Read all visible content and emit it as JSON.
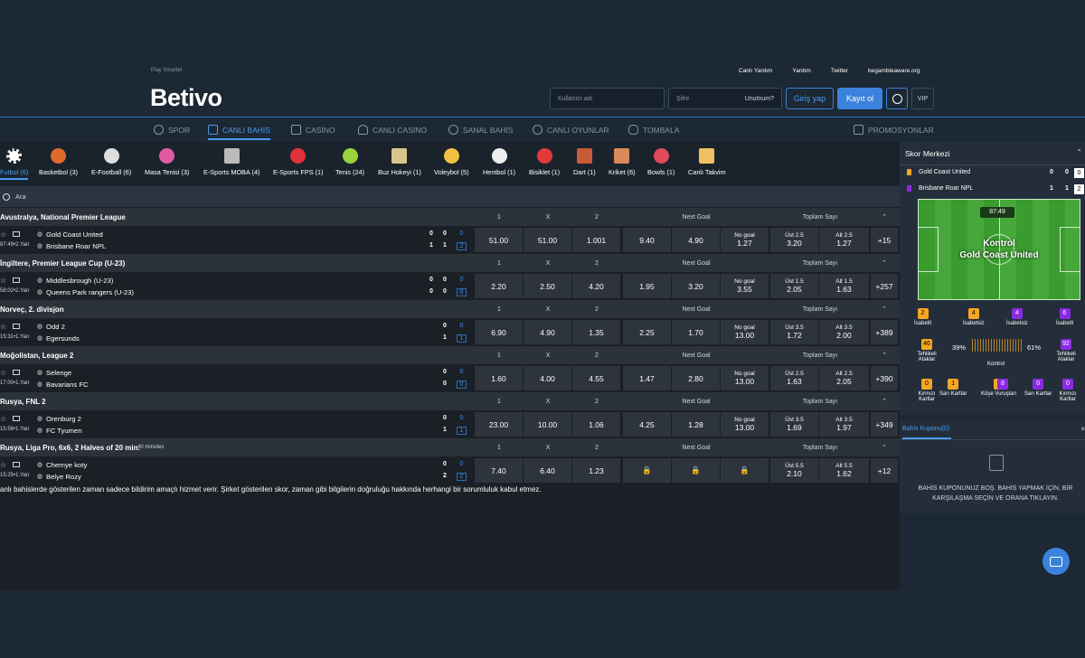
{
  "header": {
    "tagline": "Play Smarter",
    "logo": "Betivo",
    "links": [
      "Canlı Yardım",
      "Yardım",
      "Twitter",
      "begambleaware.org"
    ],
    "username_placeholder": "Kullanıcı adı",
    "password_placeholder": "Şifre",
    "forgot": "Unutnum?",
    "login": "Giriş yap",
    "register": "Kayıt ol",
    "vip": "VIP"
  },
  "nav": [
    {
      "label": "SPOR",
      "icon": "football-icon"
    },
    {
      "label": "CANLI BAHİS",
      "icon": "live-icon"
    },
    {
      "label": "CASİNO",
      "icon": "slot-icon"
    },
    {
      "label": "CANLI CASİNO",
      "icon": "spade-icon"
    },
    {
      "label": "SANAL BAHİS",
      "icon": "virtual-icon"
    },
    {
      "label": "CANLI OYUNLAR",
      "icon": "games-icon"
    },
    {
      "label": "TOMBALA",
      "icon": "tombala-icon"
    },
    {
      "label": "PROMOSYONLAR",
      "icon": "gift-icon"
    }
  ],
  "sports": [
    "Futbol (6)",
    "Basketbol (3)",
    "E-Football (6)",
    "Masa Tenisi (3)",
    "E-Sports MOBA (4)",
    "E-Sports FPS (1)",
    "Tenis (24)",
    "Buz Hokeyi (1)",
    "Voleybol (5)",
    "Hentbol (1)",
    "Bisiklet (1)",
    "Dart (1)",
    "Kriket (6)",
    "Bowls (1)",
    "Canlı Takvim"
  ],
  "search_placeholder": "Ara",
  "columns": {
    "c1": "1",
    "cx": "X",
    "c2": "2",
    "next_goal": "Next Goal",
    "total": "Toplam Sayı"
  },
  "leagues": [
    {
      "name": "Avustralya, National Premier League",
      "extra": "",
      "clock": "87:49•2.Yarı",
      "home": "Gold Coast United",
      "away": "Brisbane Roar NPL",
      "hs": [
        "0",
        "0",
        "0"
      ],
      "as": [
        "1",
        "1",
        "2"
      ],
      "o1": "51.00",
      "ox": "51.00",
      "o2": "1.001",
      "ng1": "9.40",
      "ng2": "4.90",
      "ngl": "No goal",
      "ng3": "1.27",
      "tl": "Üst 2.5",
      "tv": "3.20",
      "tr": "Alt 2.5",
      "tv2": "1.27",
      "more": "+15"
    },
    {
      "name": "İngiltere, Premier League Cup (U-23)",
      "extra": "",
      "clock": "58:02•2.Yarı",
      "home": "Middlesbrough (U-23)",
      "away": "Queens Park rangers (U-23)",
      "hs": [
        "0",
        "0",
        "0"
      ],
      "as": [
        "0",
        "0",
        "0"
      ],
      "o1": "2.20",
      "ox": "2.50",
      "o2": "4.20",
      "ng1": "1.95",
      "ng2": "3.20",
      "ngl": "No goal",
      "ng3": "3.55",
      "tl": "Üst 1.5",
      "tv": "2.05",
      "tr": "Alt 1.5",
      "tv2": "1.63",
      "more": "+257"
    },
    {
      "name": "Norveç, 2. divisjon",
      "extra": "",
      "clock": "15:31•1.Yarı",
      "home": "Odd 2",
      "away": "Egersunds",
      "hs": [
        "",
        "0",
        "0"
      ],
      "as": [
        "",
        "1",
        "1"
      ],
      "o1": "6.90",
      "ox": "4.90",
      "o2": "1.35",
      "ng1": "2.25",
      "ng2": "1.70",
      "ngl": "No goal",
      "ng3": "13.00",
      "tl": "Üst 3.5",
      "tv": "1.72",
      "tr": "Alt 3.5",
      "tv2": "2.00",
      "more": "+389"
    },
    {
      "name": "Moğolistan, League 2",
      "extra": "",
      "clock": "17:00•1.Yarı",
      "home": "Selenge",
      "away": "Bavarians FC",
      "hs": [
        "",
        "0",
        "0"
      ],
      "as": [
        "",
        "0",
        "0"
      ],
      "o1": "1.60",
      "ox": "4.00",
      "o2": "4.55",
      "ng1": "1.47",
      "ng2": "2.80",
      "ngl": "No goal",
      "ng3": "13.00",
      "tl": "Üst 2.5",
      "tv": "1.63",
      "tr": "Alt 2.5",
      "tv2": "2.05",
      "more": "+390"
    },
    {
      "name": "Rusya, FNL 2",
      "extra": "",
      "clock": "15:56•1.Yarı",
      "home": "Orenburg 2",
      "away": "FC Tyumen",
      "hs": [
        "",
        "0",
        "0"
      ],
      "as": [
        "",
        "1",
        "1"
      ],
      "o1": "23.00",
      "ox": "10.00",
      "o2": "1.06",
      "ng1": "4.25",
      "ng2": "1.28",
      "ngl": "No goal",
      "ng3": "13.00",
      "tl": "Üst 3.5",
      "tv": "1.69",
      "tr": "Alt 3.5",
      "tv2": "1.97",
      "more": "+349"
    },
    {
      "name": "Rusya, Liga Pro, 6x6, 2 Halves of 20 min.",
      "extra": "40 minutes",
      "clock": "15:25•1.Yarı",
      "home": "Chernye koty",
      "away": "Belye Rozy",
      "hs": [
        "",
        "0",
        "0"
      ],
      "as": [
        "",
        "2",
        "2"
      ],
      "o1": "7.40",
      "ox": "6.40",
      "o2": "1.23",
      "ng1": "",
      "ng2": "",
      "ngl": "",
      "ng3": "",
      "tl": "Üst 5.5",
      "tv": "2.10",
      "tr": "Alt 5.5",
      "tv2": "1.62",
      "more": "+12",
      "locked": true
    }
  ],
  "disclaimer": "anlı bahislerde gösterilen zaman sadece bildirim amaçlı hizmet verir. Şirket gösterilen skor, zaman gibi bilgilerin doğruluğu hakkında herhangi bir sorumluluk kabul etmez.",
  "score_center": {
    "title": "Skor Merkezi",
    "team1": "Gold Coast United",
    "team2": "Brisbane Roar NPL",
    "t1s": [
      "0",
      "0",
      "0"
    ],
    "t2s": [
      "1",
      "1",
      "2"
    ],
    "time": "87:49",
    "control_label": "Kontrol",
    "control_team": "Gold Coast United",
    "stats": [
      {
        "v": "2",
        "l": "İsabetli"
      },
      {
        "v": "4",
        "l": "İsabetsiz"
      },
      {
        "v": "4",
        "l": "İsabetsiz"
      },
      {
        "v": "6",
        "l": "İsabetli"
      }
    ],
    "danger_left": "46",
    "danger_label": "Tehlikeli Ataklar",
    "pct_left": "39%",
    "pct_right": "61%",
    "ctrl": "Kontrol",
    "danger_right": "92",
    "cards": [
      {
        "v": "0",
        "l": "Kırmızı Kartlar"
      },
      {
        "v": "1",
        "l": "Sarı Kartlar"
      },
      {
        "v": "2",
        "l": "Köşe Vuruşları"
      },
      {
        "v": "8",
        "l": ""
      },
      {
        "v": "0",
        "l": "Sarı Kartlar"
      },
      {
        "v": "0",
        "l": "Kırmızı Kartlar"
      }
    ]
  },
  "coupon": {
    "title": "Bahis Kuponu(0)",
    "empty": "BAHİS KUPONUNUZ BOŞ. BAHİS YAPMAK İÇİN, BİR KARŞILAŞMA SEÇİN VE ORANA TIKLAYIN."
  },
  "colors": {
    "accent": "#3b82dd",
    "home": "#f5a623",
    "away": "#8a2be2",
    "pitch": "#3a9b2e"
  }
}
